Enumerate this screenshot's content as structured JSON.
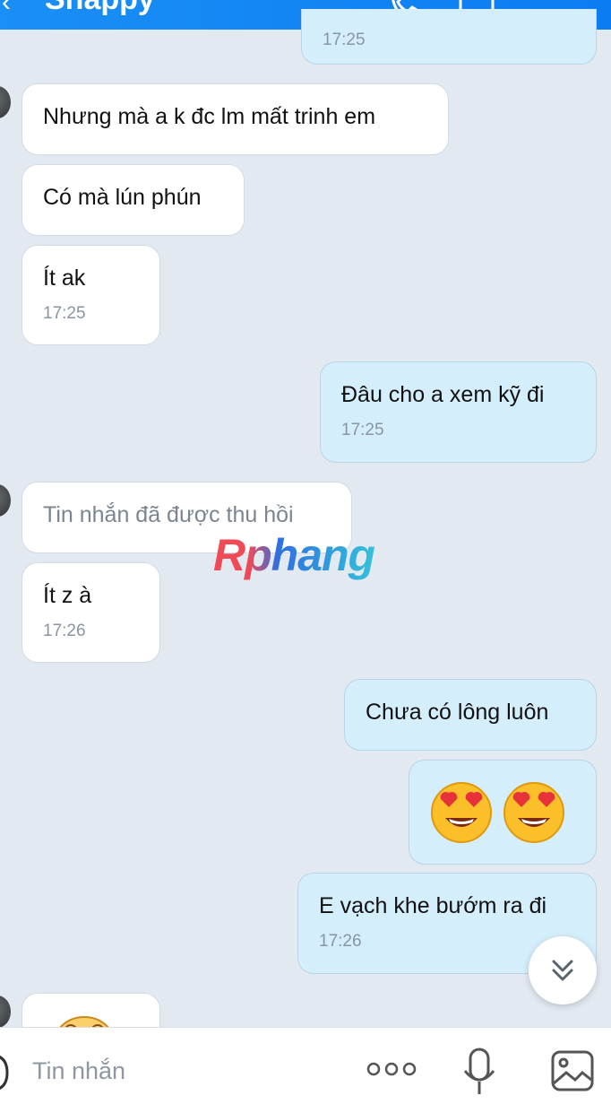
{
  "header": {
    "title": "Snappy",
    "back_icon": "back-arrow-icon",
    "call_icon": "phone-icon",
    "video_icon": "video-icon",
    "menu_icon": "list-menu-icon"
  },
  "messages": [
    {
      "dir": "out",
      "text": "",
      "time": "17:25"
    },
    {
      "dir": "in",
      "text": "Nhưng mà a k đc lm mất trinh em"
    },
    {
      "dir": "in",
      "text": "Có mà lún phún"
    },
    {
      "dir": "in",
      "text": "Ít ak",
      "time": "17:25"
    },
    {
      "dir": "out",
      "text": "Đâu cho a xem kỹ đi",
      "time": "17:25"
    },
    {
      "dir": "in",
      "text": "Tin nhắn đã được thu hồi",
      "recalled": true
    },
    {
      "dir": "in",
      "text": "Ít z à",
      "time": "17:26"
    },
    {
      "dir": "out",
      "text": "Chưa có lông luôn"
    },
    {
      "dir": "out",
      "emoji": [
        "heart-eyes-emoji",
        "heart-eyes-emoji"
      ]
    },
    {
      "dir": "out",
      "text": "E vạch khe bướm ra đi",
      "time": "17:26"
    },
    {
      "dir": "in",
      "emoji": [
        "sticker-emoji"
      ]
    }
  ],
  "watermark": "Rphang",
  "input": {
    "placeholder": "Tin nhắn",
    "icons": [
      "sticker-icon",
      "more-icon",
      "microphone-icon",
      "image-icon"
    ]
  },
  "scroll_button_icon": "chevron-double-down-icon",
  "colors": {
    "header": "#1a8ff5",
    "background": "#e2e9f1",
    "incoming": "#ffffff",
    "outgoing": "#d5eefc"
  }
}
